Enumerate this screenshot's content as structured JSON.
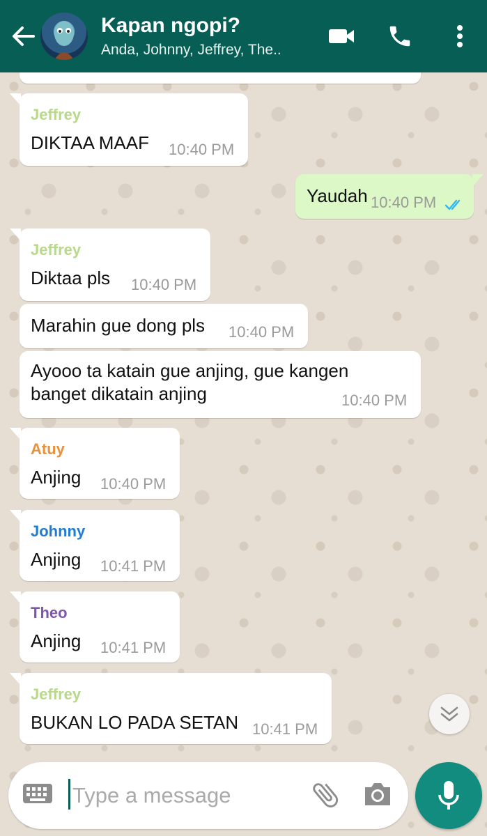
{
  "header": {
    "title": "Kapan ngopi?",
    "subtitle": "Anda, Johnny, Jeffrey, The..",
    "bg_color": "#075e54",
    "icons": [
      "back-arrow-icon",
      "group-avatar",
      "video-call-icon",
      "voice-call-icon",
      "more-options-icon"
    ]
  },
  "messages": [
    {
      "sender": "Jeffrey",
      "sender_color": "#b8d98a",
      "text": "DIKTAA MAAF",
      "time": "10:40 PM",
      "direction": "in"
    },
    {
      "sender": "",
      "text": "Yaudah",
      "time": "10:40 PM",
      "direction": "out",
      "status": "read"
    },
    {
      "sender": "Jeffrey",
      "sender_color": "#b8d98a",
      "text": "Diktaa pls",
      "time": "10:40 PM",
      "direction": "in"
    },
    {
      "sender": "",
      "text": "Marahin gue dong pls",
      "time": "10:40 PM",
      "direction": "in"
    },
    {
      "sender": "",
      "text": "Ayooo ta katain gue anjing, gue kangen banget dikatain anjing",
      "time": "10:40 PM",
      "direction": "in"
    },
    {
      "sender": "Atuy",
      "sender_color": "#e8903a",
      "text": "Anjing",
      "time": "10:40 PM",
      "direction": "in"
    },
    {
      "sender": "Johnny",
      "sender_color": "#1f7bd4",
      "text": "Anjing",
      "time": "10:41 PM",
      "direction": "in"
    },
    {
      "sender": "Theo",
      "sender_color": "#7e57a8",
      "text": "Anjing",
      "time": "10:41 PM",
      "direction": "in"
    },
    {
      "sender": "Jeffrey",
      "sender_color": "#b8d98a",
      "text": "BUKAN LO PADA SETAN",
      "time": "10:41 PM",
      "direction": "in"
    }
  ],
  "composer": {
    "placeholder": "Type a message",
    "value": ""
  },
  "colors": {
    "incoming_bubble": "#ffffff",
    "outgoing_bubble": "#dcf8c6",
    "read_check": "#34b7f1",
    "fab": "#128c7e"
  }
}
